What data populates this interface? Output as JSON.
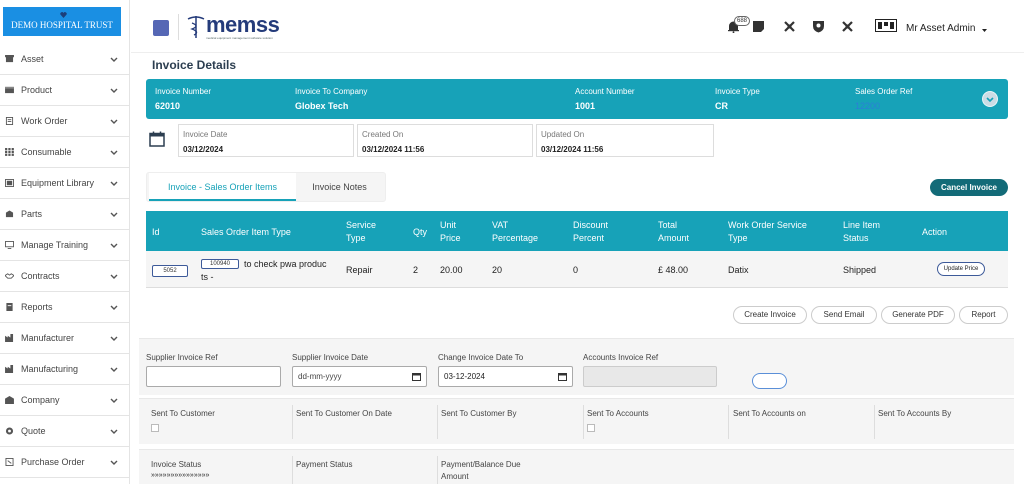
{
  "brand": {
    "name": "DEMO HOSPITAL TRUST"
  },
  "sidebar": {
    "items": [
      {
        "label": "Asset",
        "icon": "box-icon"
      },
      {
        "label": "Product",
        "icon": "package-icon"
      },
      {
        "label": "Work Order",
        "icon": "clipboard-icon"
      },
      {
        "label": "Consumable",
        "icon": "grid-icon"
      },
      {
        "label": "Equipment Library",
        "icon": "library-icon"
      },
      {
        "label": "Parts",
        "icon": "parts-icon"
      },
      {
        "label": "Manage Training",
        "icon": "monitor-icon"
      },
      {
        "label": "Contracts",
        "icon": "handshake-icon"
      },
      {
        "label": "Reports",
        "icon": "report-icon"
      },
      {
        "label": "Manufacturer",
        "icon": "factory-icon"
      },
      {
        "label": "Manufacturing",
        "icon": "factory-icon"
      },
      {
        "label": "Company",
        "icon": "building-icon"
      },
      {
        "label": "Quote",
        "icon": "quote-icon"
      },
      {
        "label": "Purchase Order",
        "icon": "purchase-icon"
      }
    ]
  },
  "topbar": {
    "logo_text": "memss",
    "logo_sub": "medical equipment management software solution",
    "notification_count": "688",
    "user_name": "Mr Asset Admin"
  },
  "page": {
    "title": "Invoice Details"
  },
  "summary": {
    "invoice_number_label": "Invoice Number",
    "invoice_number": "62010",
    "company_label": "Invoice To Company",
    "company": "Globex Tech",
    "account_label": "Account Number",
    "account": "1001",
    "type_label": "Invoice Type",
    "type": "CR",
    "sales_ref_label": "Sales Order Ref",
    "sales_ref": "12200"
  },
  "dates": {
    "invoice_date_label": "Invoice Date",
    "invoice_date": "03/12/2024",
    "created_label": "Created On",
    "created": "03/12/2024 11:56",
    "updated_label": "Updated On",
    "updated": "03/12/2024 11:56"
  },
  "tabs": {
    "items": "Invoice - Sales Order Items",
    "notes": "Invoice Notes"
  },
  "actions": {
    "cancel_invoice": "Cancel Invoice",
    "create_invoice": "Create Invoice",
    "send_email": "Send Email",
    "generate_pdf": "Generate PDF",
    "report": "Report",
    "update_price": "Update Price"
  },
  "table": {
    "headers": {
      "id": "Id",
      "item_type": "Sales Order Item Type",
      "service_type_1": "Service",
      "service_type_2": "Type",
      "qty": "Qty",
      "unit_price_1": "Unit",
      "unit_price_2": "Price",
      "vat_1": "VAT",
      "vat_2": "Percentage",
      "discount_1": "Discount",
      "discount_2": "Percent",
      "total_1": "Total",
      "total_2": "Amount",
      "wo_service_1": "Work Order Service",
      "wo_service_2": "Type",
      "status_1": "Line Item",
      "status_2": "Status",
      "action": "Action"
    },
    "row": {
      "id": "5052",
      "item_code": "100940",
      "item_desc_1": "to check pwa produc",
      "item_desc_2": "ts -",
      "service_type": "Repair",
      "qty": "2",
      "unit_price": "20.00",
      "vat": "20",
      "discount": "0",
      "total": "£ 48.00",
      "wo_service": "Datix",
      "status": "Shipped"
    }
  },
  "form": {
    "supplier_ref_label": "Supplier Invoice Ref",
    "supplier_ref_value": "",
    "supplier_date_label": "Supplier Invoice Date",
    "supplier_date_placeholder": "dd-mm-yyyy",
    "change_date_label": "Change Invoice Date To",
    "change_date_value": "03-12-2024",
    "accounts_ref_label": "Accounts Invoice Ref"
  },
  "sent": {
    "to_customer": "Sent To Customer",
    "to_customer_date": "Sent To Customer On Date",
    "to_customer_by": "Sent To Customer By",
    "to_accounts": "Sent To Accounts",
    "to_accounts_on": "Sent To Accounts on",
    "to_accounts_by": "Sent To Accounts By"
  },
  "status": {
    "invoice_status_label": "Invoice Status",
    "invoice_status_value": "»»»»»»»»»»»»»»»",
    "payment_status_label": "Payment Status",
    "payment_due_label_1": "Payment/Balance Due",
    "payment_due_label_2": "Amount"
  },
  "colors": {
    "accent": "#17a2b8",
    "brand": "#1a8fe3",
    "dark_button": "#136b78"
  }
}
